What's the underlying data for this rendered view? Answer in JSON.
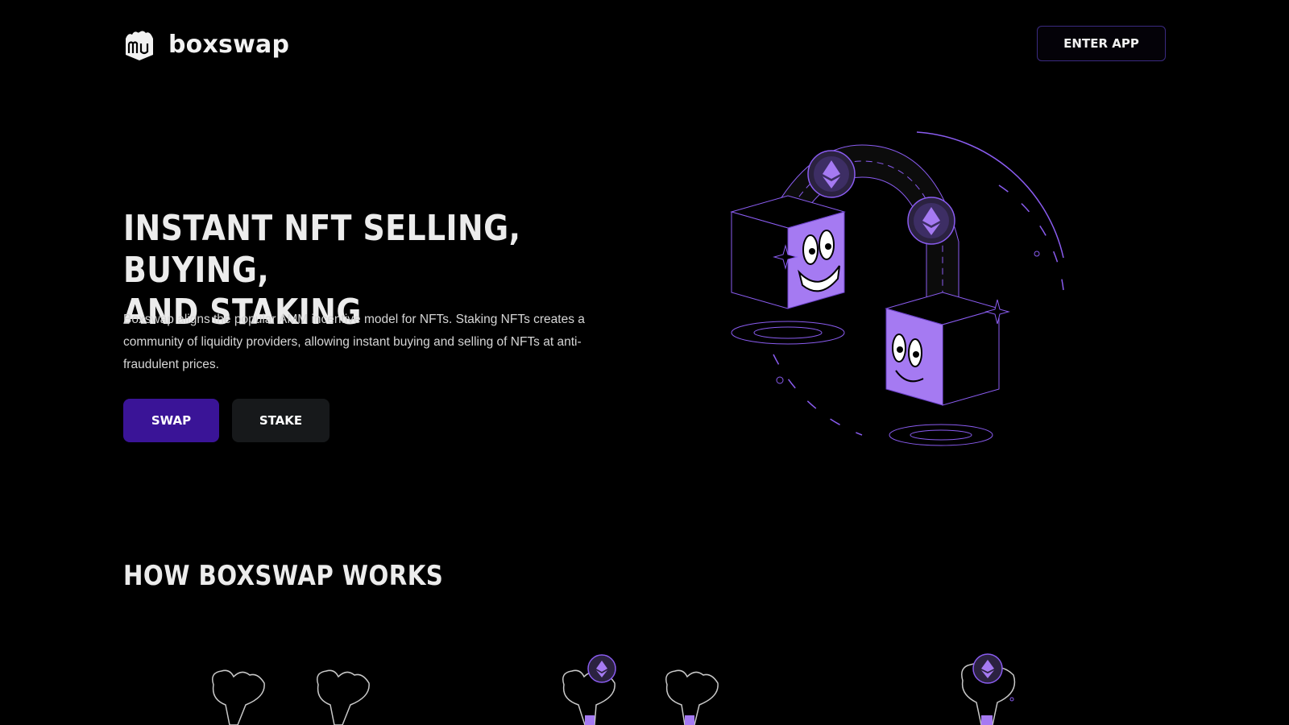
{
  "header": {
    "brand": "boxswap",
    "logo_icon": "box-logo-icon",
    "enter_app_label": "ENTER APP"
  },
  "hero": {
    "title_line1": "INSTANT NFT SELLING, BUYING,",
    "title_line2": "AND STAKING",
    "description": "Boxswap aligns the popular AMM incentive model for NFTs. Staking NFTs creates a community of liquidity providers, allowing instant buying and selling of NFTs at anti-fraudulent prices.",
    "swap_label": "SWAP",
    "stake_label": "STAKE",
    "illustration_icons": [
      "smiling-box-icon",
      "ethereum-coin-icon",
      "happy-box-icon"
    ]
  },
  "how_it_works": {
    "title": "HOW BOXSWAP WORKS",
    "illustration_icons": [
      "open-hands-icon",
      "hand-with-ethereum-coin-icon",
      "hand-holding-ethereum-coin-icon"
    ]
  },
  "colors": {
    "background": "#000000",
    "accent_purple": "#9b6cf0",
    "swap_button": "#3a1497",
    "stake_button": "#17191b",
    "text": "#ececec"
  }
}
